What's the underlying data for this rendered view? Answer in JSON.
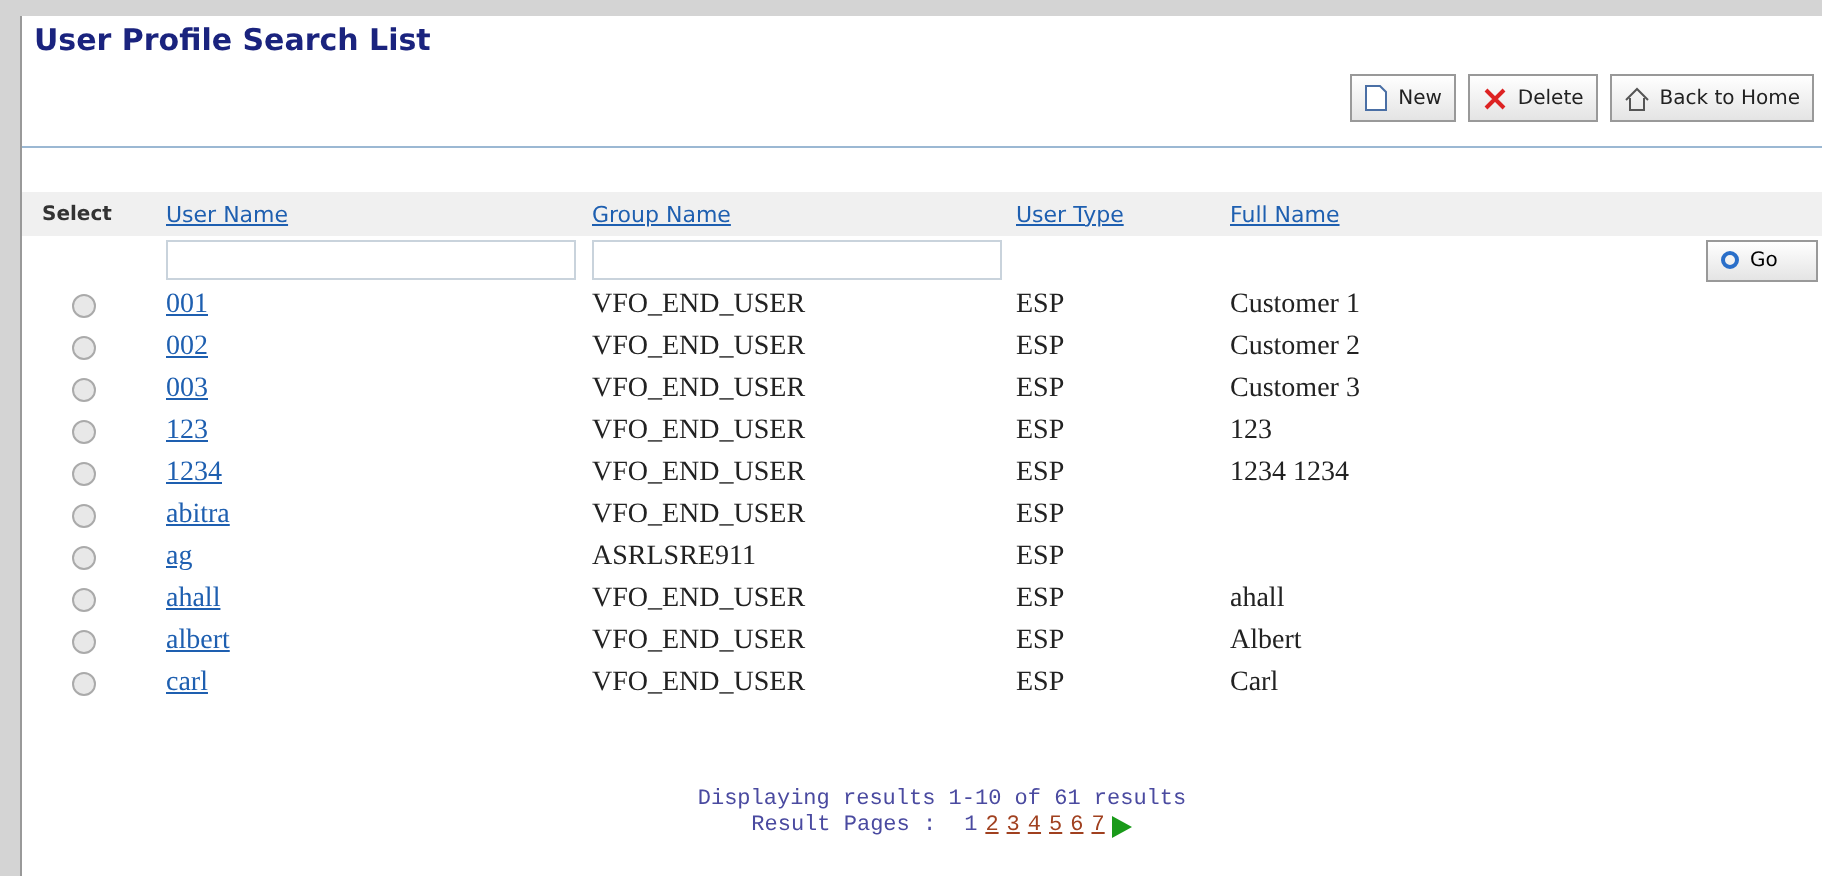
{
  "title": "User Profile Search List",
  "toolbar": [
    {
      "label": "New",
      "kind": "new"
    },
    {
      "label": "Delete",
      "kind": "delete"
    },
    {
      "label": "Back to Home",
      "kind": "home"
    }
  ],
  "table": {
    "select_label": "Select",
    "columns": [
      "User Name",
      "Group Name",
      "User Type",
      "Full Name"
    ],
    "filters": [
      {
        "kind": "text"
      },
      {
        "kind": "text"
      }
    ],
    "go_label": "Go",
    "rows": [
      {
        "selected": false,
        "cells": [
          "001",
          "VFO_END_USER",
          "ESP",
          "Customer 1"
        ]
      },
      {
        "selected": false,
        "cells": [
          "002",
          "VFO_END_USER",
          "ESP",
          "Customer 2"
        ]
      },
      {
        "selected": false,
        "cells": [
          "003",
          "VFO_END_USER",
          "ESP",
          "Customer 3"
        ]
      },
      {
        "selected": false,
        "cells": [
          "123",
          "VFO_END_USER",
          "ESP",
          "123"
        ]
      },
      {
        "selected": false,
        "cells": [
          "1234",
          "VFO_END_USER",
          "ESP",
          "1234 1234"
        ]
      },
      {
        "selected": false,
        "cells": [
          "abitra",
          "VFO_END_USER",
          "ESP",
          ""
        ]
      },
      {
        "selected": false,
        "cells": [
          "ag",
          "ASRLSRE911",
          "ESP",
          ""
        ]
      },
      {
        "selected": false,
        "cells": [
          "ahall",
          "VFO_END_USER",
          "ESP",
          "ahall"
        ]
      },
      {
        "selected": false,
        "cells": [
          "albert",
          "VFO_END_USER",
          "ESP",
          "Albert"
        ]
      },
      {
        "selected": false,
        "cells": [
          "carl",
          "VFO_END_USER",
          "ESP",
          "Carl"
        ]
      }
    ]
  },
  "pagination": {
    "summary": "Displaying results 1-10 of 61 results",
    "pages_label": "Result Pages :",
    "pages": [
      {
        "label": "1",
        "selected": true
      },
      {
        "label": "2",
        "selected": false
      },
      {
        "label": "3",
        "selected": false
      },
      {
        "label": "4",
        "selected": false
      },
      {
        "label": "5",
        "selected": false
      },
      {
        "label": "6",
        "selected": false
      },
      {
        "label": "7",
        "selected": false
      }
    ],
    "has_next": true
  }
}
